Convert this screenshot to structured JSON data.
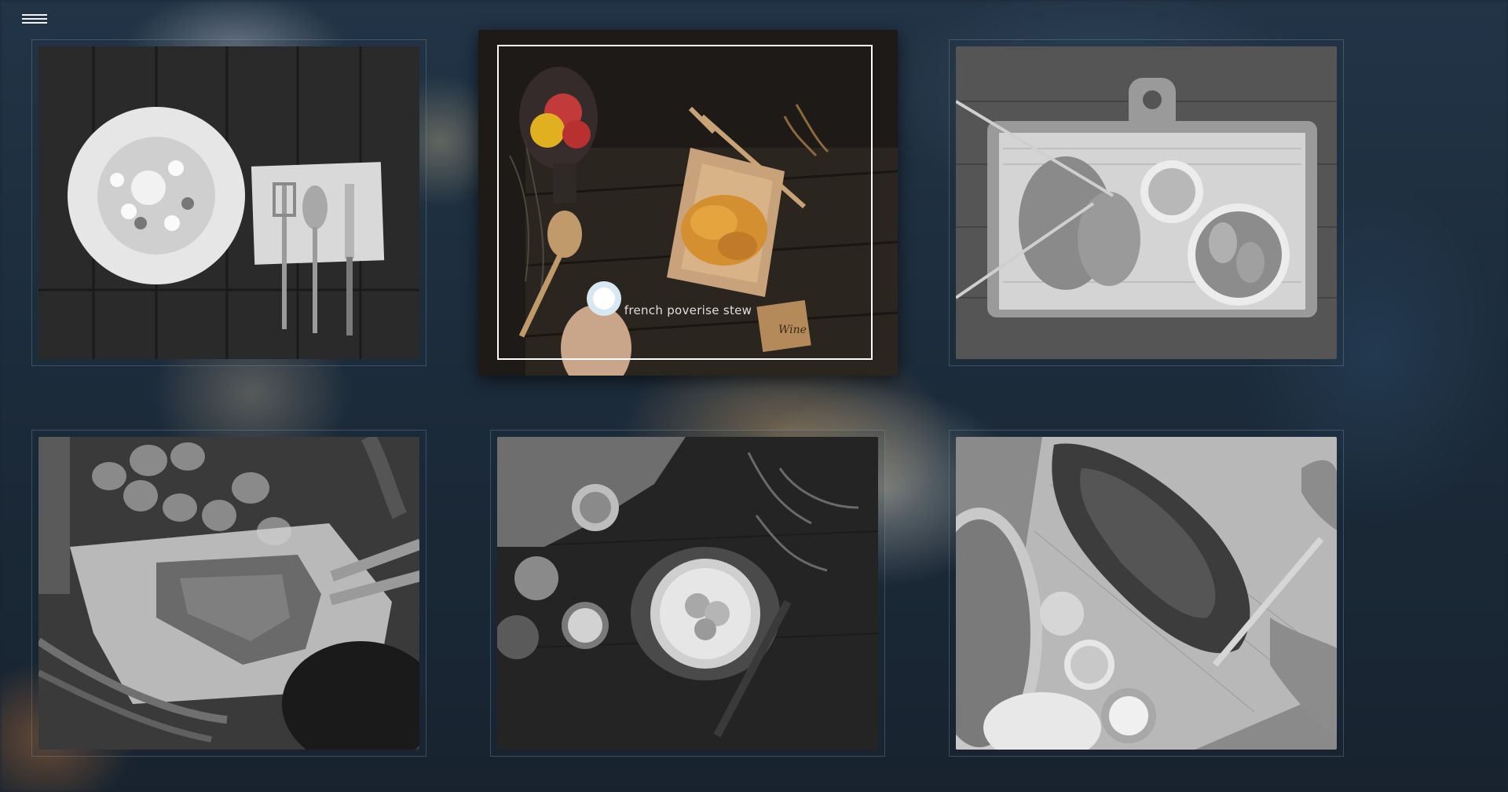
{
  "navigation": {
    "menu_icon": "hamburger-menu-icon"
  },
  "gallery": {
    "tiles": [
      {
        "subject": "plate-with-cutlery",
        "caption": ""
      },
      {
        "subject": "croissant-tray",
        "caption": "french poverise stew"
      },
      {
        "subject": "fish-and-chips-board",
        "caption": ""
      },
      {
        "subject": "raw-steak-vegetables",
        "caption": ""
      },
      {
        "subject": "cake-on-table",
        "caption": ""
      },
      {
        "subject": "roast-meat-carving",
        "caption": ""
      }
    ],
    "active_caption": "french poverise stew",
    "tag_text": "Wine"
  },
  "colors": {
    "background": "#1a2633",
    "frame": "#ffffff",
    "tile_border": "#5b6b7b"
  }
}
